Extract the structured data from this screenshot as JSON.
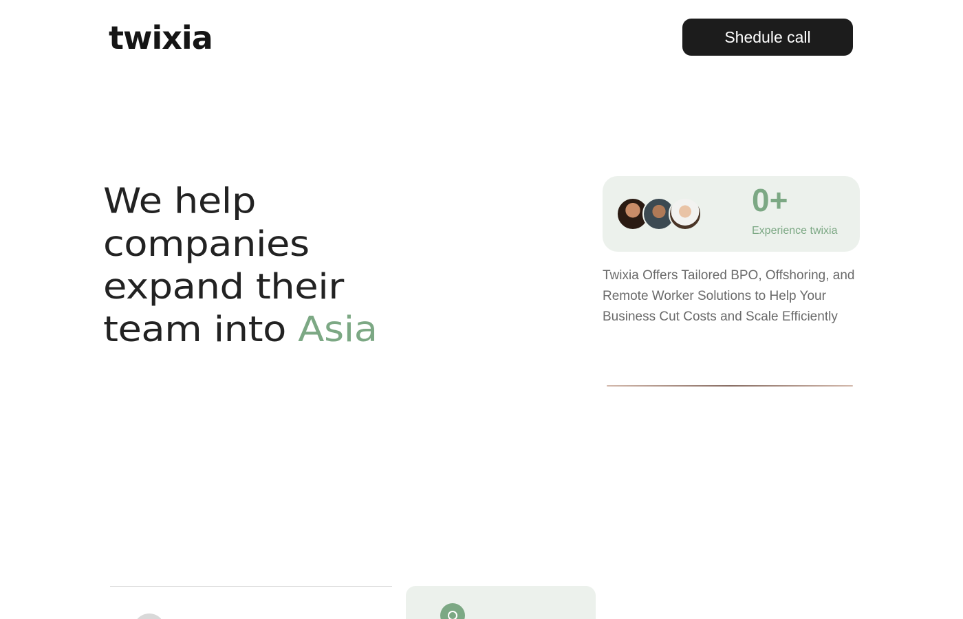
{
  "header": {
    "logo_text": "twixia",
    "cta_label": "Shedule call"
  },
  "hero": {
    "line1": "We help",
    "line2": "companies",
    "line3": "expand their",
    "line4_prefix": "team into ",
    "line4_accent": "Asia"
  },
  "stat_card": {
    "value": "0+",
    "label": "Experience twixia"
  },
  "description": "Twixia Offers Tailored BPO, Offshoring, and Remote Worker Solutions to Help Your Business Cut Costs and Scale Efficiently",
  "colors": {
    "accent": "#7ca884",
    "card_background": "#ecf1ec",
    "button_background": "#1c1c1c"
  },
  "icons": {
    "avatar_1": "person-avatar",
    "avatar_2": "person-avatar",
    "avatar_3": "person-avatar",
    "bottom_card_icon": "circle-icon"
  }
}
